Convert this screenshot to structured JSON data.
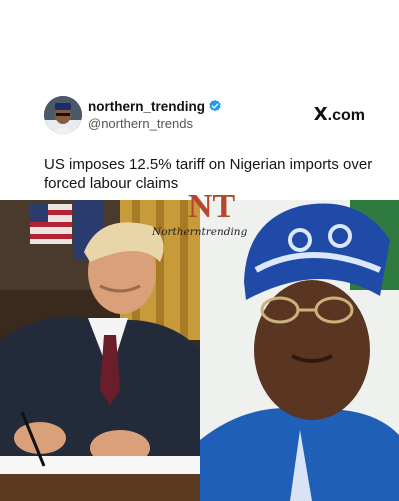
{
  "post": {
    "display_name": "northern_trending",
    "handle": "@northern_trends",
    "verified": true,
    "verified_icon": "verified-badge-icon",
    "source_logo": "X",
    "source_domain": ".com",
    "text": "US imposes 12.5% tariff on Nigerian imports over forced labour claims"
  },
  "watermark": {
    "letters": "NT",
    "text": "Northerntrending"
  },
  "colors": {
    "verified": "#1d9bf0",
    "watermark_n": "#b08a55",
    "watermark_t": "#c0392b"
  }
}
